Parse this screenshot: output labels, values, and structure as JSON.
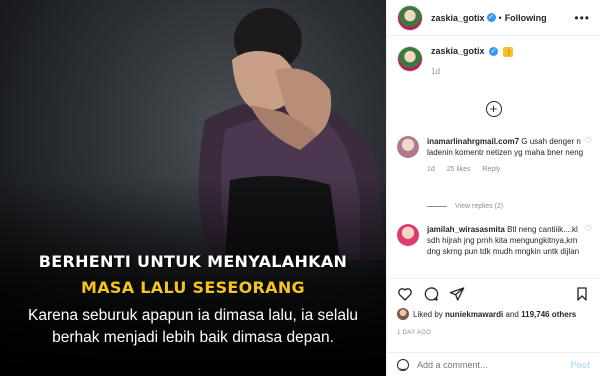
{
  "post_image": {
    "headline_line1": "BERHENTI UNTUK MENYALAHKAN",
    "headline_line2": "MASA LALU SESEORANG",
    "body_line1": "Karena seburuk apapun ia dimasa lalu, ia selalu",
    "body_line2": "berhak menjadi lebih baik dimasa depan."
  },
  "header": {
    "username": "zaskia_gotix",
    "verified_icon": "✓",
    "separator": "•",
    "follow_status": "Following",
    "more_icon": "•••"
  },
  "caption": {
    "username": "zaskia_gotix",
    "emoji": "👍",
    "time": "1d"
  },
  "load_more_icon": "+",
  "comments": [
    {
      "username": "inamarlinahrgmail.com7",
      "text": "G usah denger n ladenin komentr netizen yg maha bner neng",
      "time": "1d",
      "likes": "25 likes",
      "reply": "Reply",
      "view_replies": "View replies (2)"
    },
    {
      "username": "jamilah_wirasasmita",
      "text": "Btl neng cantiiik....kl sdh hijrah jng prnh kita mengungkitnya,krn dng skrng pun tdk mudh mngkin untk dijlan"
    }
  ],
  "likes": {
    "prefix": "Liked by",
    "user": "nuniekmawardi",
    "middle": "and",
    "count": "119,746 others"
  },
  "posted_ago": "1 DAY AGO",
  "add_comment": {
    "placeholder": "Add a comment...",
    "post_label": "Post"
  },
  "colors": {
    "accent_yellow": "#f5c518",
    "link_blue": "#3897f0",
    "post_disabled": "#b2dffc"
  }
}
